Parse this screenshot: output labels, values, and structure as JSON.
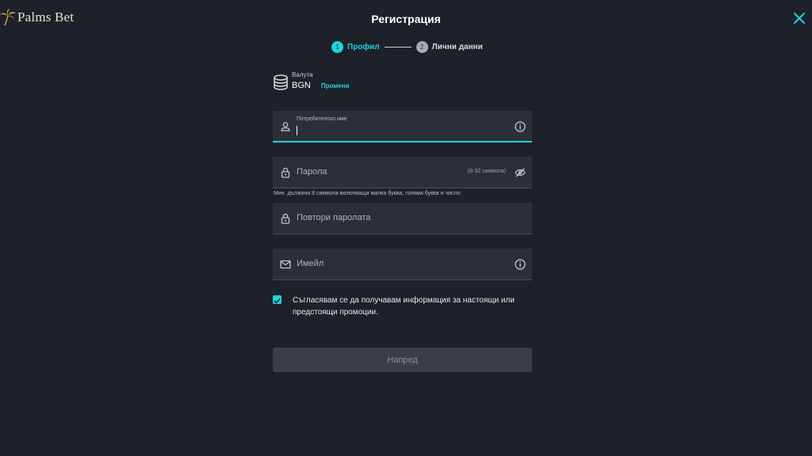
{
  "brand": {
    "name": "Palms Bet"
  },
  "header": {
    "title": "Регистрация"
  },
  "stepper": {
    "steps": [
      {
        "number": "1",
        "label": "Профил",
        "state": "active"
      },
      {
        "number": "2",
        "label": "Лични данни",
        "state": "inactive"
      }
    ]
  },
  "currency": {
    "label": "Валута",
    "value": "BGN",
    "change_label": "Промени"
  },
  "form": {
    "username": {
      "label": "Потребителско име",
      "value": ""
    },
    "password": {
      "placeholder": "Парола",
      "hint": "(8-32 символа)",
      "helper": "Мин. дължина 8 символа включващи малка буква, голяма буква и число"
    },
    "repeat_password": {
      "placeholder": "Повтори паролата"
    },
    "email": {
      "placeholder": "Имейл"
    },
    "consent": {
      "checked": true,
      "text": "Съгласявам се да получавам информация за настоящи или предстоящи промоции."
    },
    "next_label": "Напред"
  },
  "colors": {
    "background": "#1d212a",
    "field": "#2b2f38",
    "accent": "#1ed3da",
    "button_disabled": "#3a3e47"
  }
}
